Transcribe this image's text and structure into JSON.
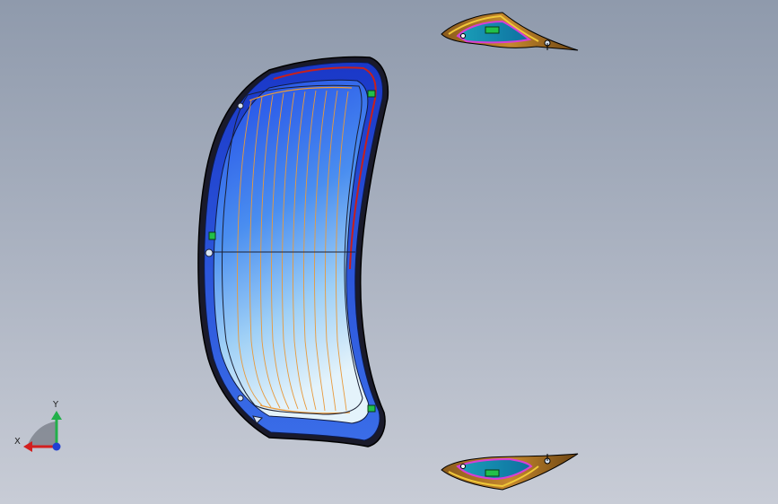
{
  "viewport": {
    "background_top": "#8f9aac",
    "background_bottom": "#c8ccd6"
  },
  "model": {
    "glass_color_top": "#1f4fe0",
    "glass_color_bottom": "#d6ecfa",
    "heater_line_color": "#e89a3c",
    "seal_color": "#c8201c",
    "clip_color": "#22c04a"
  },
  "triad": {
    "x_label": "X",
    "y_label": "Y",
    "x_color": "#d31f1f",
    "y_color": "#22b04a",
    "origin_color": "#1f3fd3"
  }
}
